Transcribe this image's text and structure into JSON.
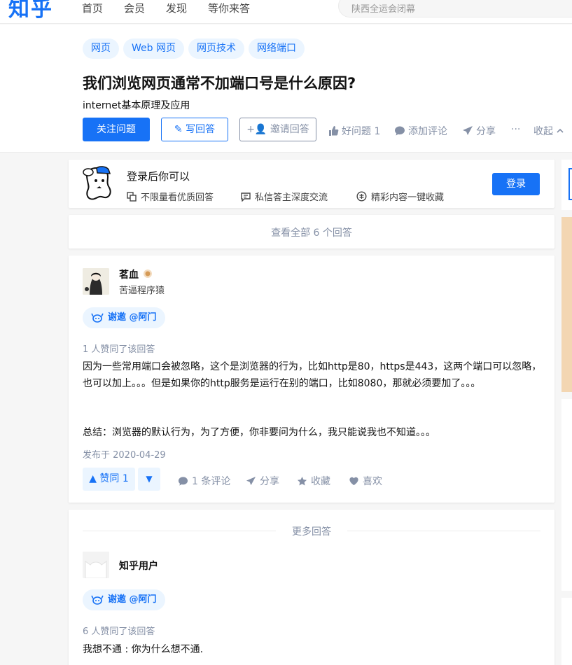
{
  "nav": {
    "logo": "知乎",
    "items": [
      "首页",
      "会员",
      "发现",
      "等你来答"
    ],
    "search_placeholder": "陕西全运会闭幕"
  },
  "question": {
    "tags": [
      "网页",
      "Web 网页",
      "网页技术",
      "网络端口"
    ],
    "title": "我们浏览网页通常不加端口号是什么原因?",
    "detail": "internet基本原理及应用",
    "follow_label": "关注问题",
    "write_label": "写回答",
    "invite_label": "邀请回答",
    "good_question": "好问题 1",
    "add_comment": "添加评论",
    "share": "分享",
    "more": "···",
    "collapse": "收起"
  },
  "login_prompt": {
    "title": "登录后你可以",
    "features": [
      "不限量看优质回答",
      "私信答主深度交流",
      "精彩内容一键收藏"
    ],
    "login_label": "登录"
  },
  "view_all": "查看全部 6 个回答",
  "answer": {
    "author": "茗血",
    "headline": "苦逼程序猿",
    "thanks": "谢邀 @阿门",
    "vote_summary": "1 人赞同了该回答",
    "paragraphs": [
      "因为一些常用端口会被忽略，这个是浏览器的行为，比如http是80，https是443，这两个端口可以忽略，也可以加上。。。但是如果你的http服务是运行在别的端口，比如8080，那就必须要加了。。。",
      "总结：浏览器的默认行为，为了方便，你非要问为什么，我只能说我也不知道。。。"
    ],
    "published": "发布于 2020-04-29",
    "upvote": "▲ 赞同 1",
    "comments": "1 条评论",
    "share": "分享",
    "collect": "收藏",
    "like": "喜欢"
  },
  "more_answers": {
    "label": "更多回答",
    "author": "知乎用户",
    "thanks": "谢邀 @阿门",
    "vote_summary": "6 人赞同了该回答",
    "content": "我想不通 : 你为什么想不通."
  },
  "colors": {
    "brand": "#1772f6",
    "muted": "#8590a6",
    "tag_bg": "#ebf5ff"
  }
}
